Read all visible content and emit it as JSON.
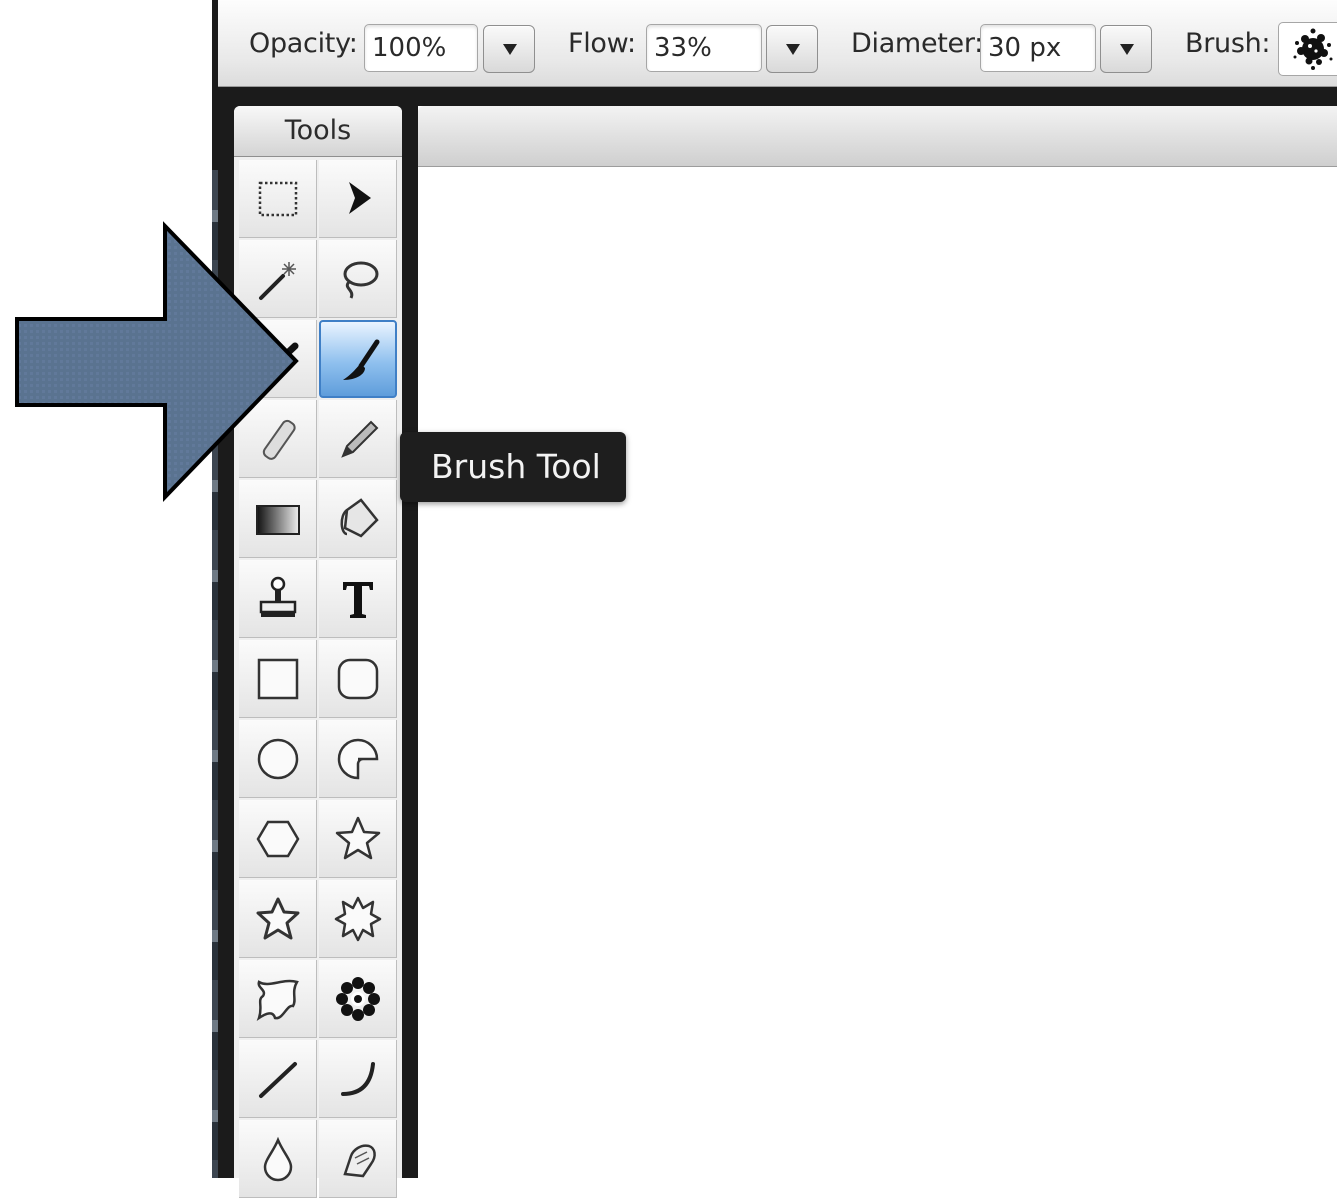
{
  "options_bar": {
    "opacity_label": "Opacity:",
    "opacity_value": "100%",
    "flow_label": "Flow:",
    "flow_value": "33%",
    "diameter_label": "Diameter:",
    "diameter_value": "30 px",
    "brush_label": "Brush:"
  },
  "tools_panel": {
    "title": "Tools",
    "selected_tool": "brush",
    "tools": [
      "rectangular-marquee",
      "move",
      "magic-wand",
      "lasso",
      "pencil-brush",
      "brush",
      "eraser",
      "pencil",
      "gradient",
      "paint-bucket",
      "clone-stamp",
      "text",
      "rectangle-shape",
      "rounded-rectangle-shape",
      "ellipse-shape",
      "pie-shape",
      "polygon-shape",
      "star-shape",
      "star-outline-shape",
      "burst-shape",
      "blob-shape",
      "flower-shape",
      "line",
      "curve",
      "blur",
      "smudge"
    ]
  },
  "tooltip": {
    "text": "Brush Tool"
  },
  "colors": {
    "selected_tool_fill": "#8fc0ee",
    "arrow_fill": "#5a7390",
    "tooltip_bg": "#1e1e1e"
  }
}
